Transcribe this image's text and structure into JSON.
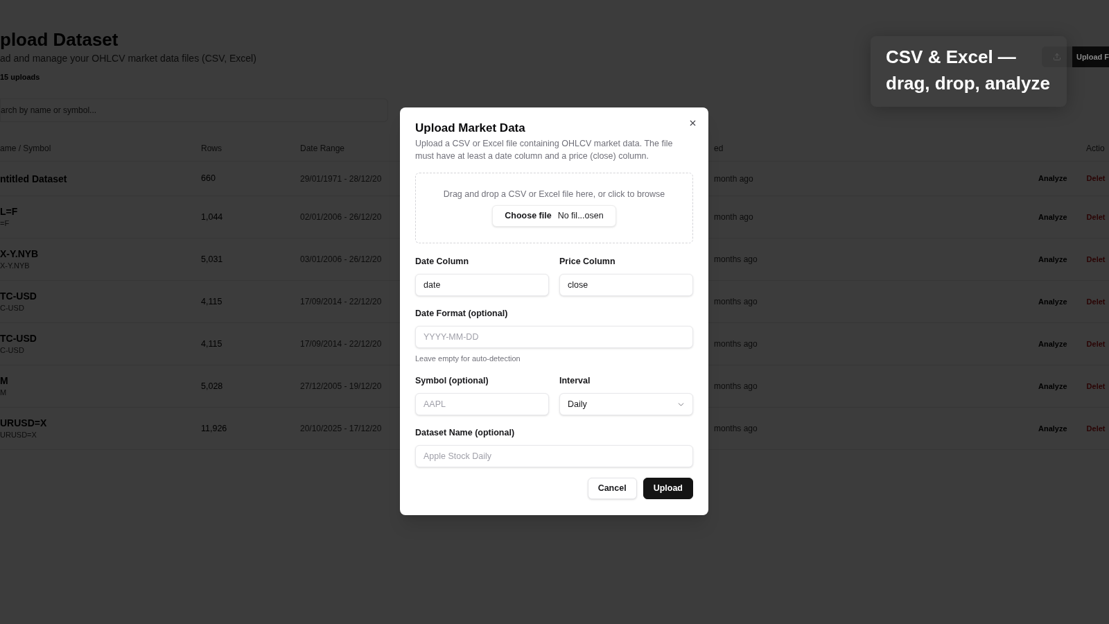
{
  "page": {
    "title": "pload Dataset",
    "subtitle": "ad and manage your OHLCV market data files (CSV, Excel)",
    "upload_count": "15 uploads",
    "search": {
      "placeholder": "arch by name or symbol..."
    },
    "upload_button": "Upload F"
  },
  "table": {
    "columns": [
      "ame / Symbol",
      "Rows",
      "Date Range",
      "ed",
      "Actio"
    ],
    "rows": [
      {
        "name": "ntitled Dataset",
        "rows": "660",
        "date_range": "29/01/1971 - 28/12/20",
        "uploaded": "month ago",
        "actions": [
          {
            "label": "Analyze",
            "kind": "analyze"
          },
          {
            "label": "Delet",
            "kind": "delete"
          }
        ]
      },
      {
        "name": "L=F",
        "symbol": "=F",
        "rows": "1,044",
        "date_range": "02/01/2006 - 26/12/20",
        "uploaded": "month ago",
        "actions": [
          {
            "label": "Analyze",
            "kind": "analyze"
          },
          {
            "label": "Delet",
            "kind": "delete"
          }
        ]
      },
      {
        "name": "X-Y.NYB",
        "symbol": "X-Y.NYB",
        "rows": "5,031",
        "date_range": "03/01/2006 - 26/12/20",
        "uploaded": "months ago",
        "actions": [
          {
            "label": "Analyze",
            "kind": "analyze"
          },
          {
            "label": "Delet",
            "kind": "delete"
          }
        ]
      },
      {
        "name": "TC-USD",
        "symbol": "C-USD",
        "rows": "4,115",
        "date_range": "17/09/2014 - 22/12/20",
        "uploaded": "months ago",
        "actions": [
          {
            "label": "Analyze",
            "kind": "analyze"
          },
          {
            "label": "Delet",
            "kind": "delete"
          }
        ]
      },
      {
        "name": "TC-USD",
        "symbol": "C-USD",
        "rows": "4,115",
        "date_range": "17/09/2014 - 22/12/20",
        "uploaded": "months ago",
        "actions": [
          {
            "label": "Analyze",
            "kind": "analyze"
          },
          {
            "label": "Delet",
            "kind": "delete"
          }
        ]
      },
      {
        "name": "M",
        "symbol": "M",
        "rows": "5,028",
        "date_range": "27/12/2005 - 19/12/20",
        "uploaded": "months ago",
        "actions": [
          {
            "label": "Analyze",
            "kind": "analyze"
          },
          {
            "label": "Delet",
            "kind": "delete"
          }
        ]
      },
      {
        "name": "URUSD=X",
        "symbol": "URUSD=X",
        "rows": "11,926",
        "date_range": "20/10/2025 - 17/12/20",
        "uploaded": "months ago",
        "actions": [
          {
            "label": "Analyze",
            "kind": "analyze"
          },
          {
            "label": "Delet",
            "kind": "delete"
          }
        ]
      }
    ]
  },
  "caption": {
    "lines": [
      "CSV & Excel —",
      "drag, drop, analyze"
    ]
  },
  "dialog": {
    "title": "Upload Market Data",
    "description": "Upload a CSV or Excel file containing OHLCV market data. The file must have at least a date column and a price (close) column.",
    "dropzone": {
      "text": "Drag and drop a CSV or Excel file here, or click to browse",
      "file_button": "Choose file",
      "file_status": "No fil...osen"
    },
    "field_rows": [
      {
        "fields": [
          {
            "kind": "text",
            "label": "Date Column",
            "value": "date"
          },
          {
            "kind": "text",
            "label": "Price Column",
            "value": "close"
          }
        ]
      },
      {
        "fields": [
          {
            "kind": "text",
            "label": "Date Format (optional)",
            "placeholder": "YYYY-MM-DD",
            "hint": "Leave empty for auto-detection"
          }
        ]
      },
      {
        "fields": [
          {
            "kind": "text",
            "label": "Symbol (optional)",
            "placeholder": "AAPL"
          },
          {
            "kind": "select",
            "label": "Interval",
            "value": "Daily"
          }
        ]
      },
      {
        "fields": [
          {
            "kind": "text",
            "label": "Dataset Name (optional)",
            "placeholder": "Apple Stock Daily"
          }
        ]
      }
    ],
    "buttons": [
      {
        "label": "Cancel",
        "kind": "secondary"
      },
      {
        "label": "Upload",
        "kind": "primary"
      }
    ]
  }
}
